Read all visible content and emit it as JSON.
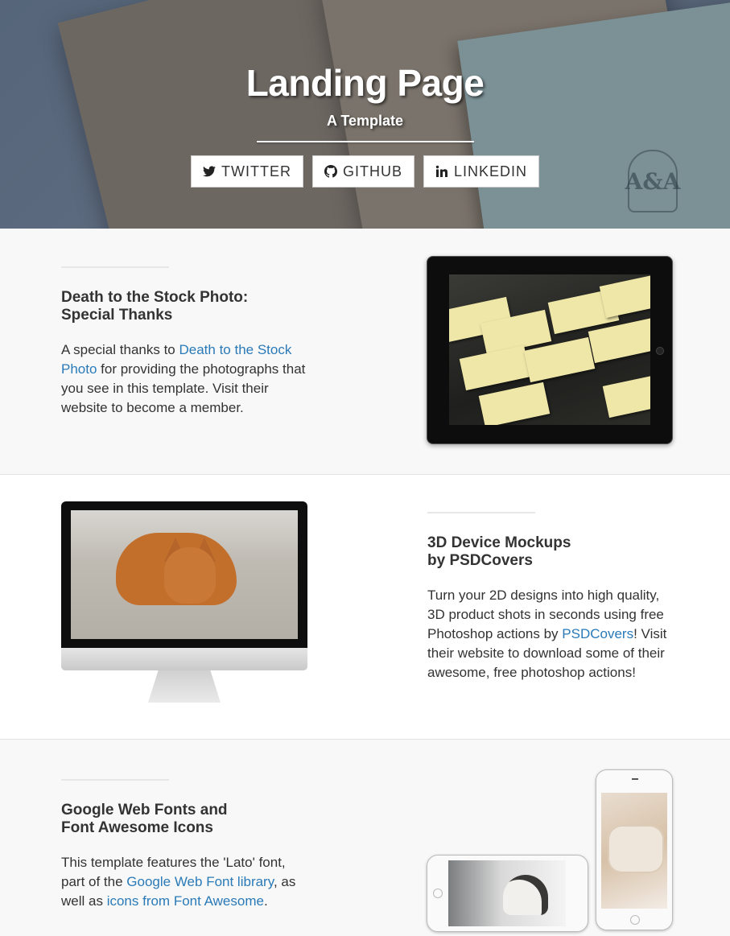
{
  "hero": {
    "title": "Landing Page",
    "subtitle": "A Template",
    "monogram": "A&A",
    "buttons": [
      {
        "label": "TWITTER",
        "icon": "twitter-icon"
      },
      {
        "label": "GITHUB",
        "icon": "github-icon"
      },
      {
        "label": "LINKEDIN",
        "icon": "linkedin-icon"
      }
    ]
  },
  "section1": {
    "heading_line1": "Death to the Stock Photo:",
    "heading_line2": "Special Thanks",
    "text_before": "A special thanks to ",
    "link": "Death to the Stock Photo",
    "text_after": " for providing the photographs that you see in this template. Visit their website to become a member.",
    "device": "ipad"
  },
  "section2": {
    "heading_line1": "3D Device Mockups",
    "heading_line2": "by PSDCovers",
    "text_before": "Turn your 2D designs into high quality, 3D product shots in seconds using free Photoshop actions by ",
    "link": "PSDCovers",
    "text_after": "! Visit their website to download some of their awesome, free photoshop actions!",
    "device": "imac",
    "logo_glyph": ""
  },
  "section3": {
    "heading_line1": "Google Web Fonts and",
    "heading_line2": "Font Awesome Icons",
    "text_before": "This template features the 'Lato' font, part of the ",
    "link1": "Google Web Font library",
    "text_middle": ", as well as ",
    "link2": "icons from Font Awesome",
    "text_after": ".",
    "device": "iphones"
  },
  "colors": {
    "link": "#2a7ab8",
    "heading": "#333333",
    "section_alt_bg": "#f8f8f8",
    "section_bg": "#ffffff"
  }
}
